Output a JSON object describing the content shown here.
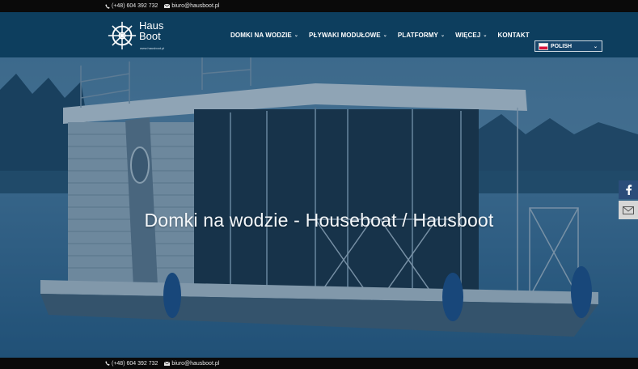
{
  "topbar": {
    "phone": "(+48) 604 392 732",
    "email": "biuro@hausboot.pl"
  },
  "logo": {
    "line1": "Haus",
    "line2": "Boot",
    "tagline": "www.hausboot.pl"
  },
  "nav": {
    "items": [
      {
        "label": "DOMKI NA WODZIE",
        "has_dropdown": true
      },
      {
        "label": "PŁYWAKI MODUŁOWE",
        "has_dropdown": true
      },
      {
        "label": "PLATFORMY",
        "has_dropdown": true
      },
      {
        "label": "WIĘCEJ",
        "has_dropdown": true
      },
      {
        "label": "KONTAKT",
        "has_dropdown": false
      }
    ]
  },
  "language": {
    "selected": "POLISH",
    "flag": "pl-flag-icon"
  },
  "hero": {
    "title": "Domki na wodzie - Houseboat / Hausboot"
  },
  "social": {
    "facebook": "facebook-icon",
    "email": "envelope-icon"
  },
  "footer": {
    "phone": "(+48) 604 392 732",
    "email": "biuro@hausboot.pl"
  },
  "colors": {
    "header": "#0e3e5f",
    "topbar": "#0a0a0a",
    "facebook": "#2b4d7a",
    "overlay": "#0c3a5f"
  }
}
